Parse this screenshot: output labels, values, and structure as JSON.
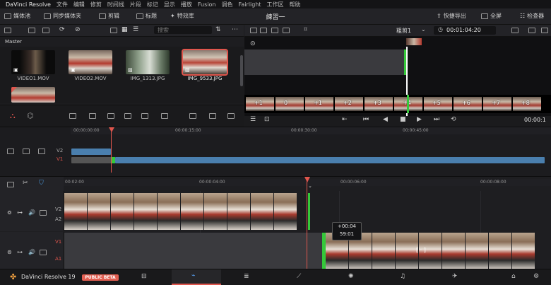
{
  "menu": [
    "DaVinci Resolve",
    "文件",
    "编辑",
    "修剪",
    "时间线",
    "片段",
    "标记",
    "显示",
    "播放",
    "Fusion",
    "调色",
    "Fairlight",
    "工作区",
    "帮助"
  ],
  "toolbar": {
    "media_pool": "媒体池",
    "sync_bin": "同步媒体夹",
    "clip": "剪辑",
    "titles": "标题",
    "effects": "特效库",
    "project_title": "練習一",
    "quick_export": "快捷导出",
    "fullscreen": "全屏",
    "inspector": "检查器"
  },
  "media_pool": {
    "search_placeholder": "搜索",
    "bin_name": "Master",
    "clips": [
      {
        "name": "VIDEO1.MOV"
      },
      {
        "name": "VIDEO2.MOV"
      },
      {
        "name": "IMG_1313.JPG"
      },
      {
        "name": "IMG_9533.JPG"
      }
    ]
  },
  "viewer": {
    "zoom": "粗剪1",
    "timecode": "00:01:04:20",
    "playhead_tc": "00:00:1",
    "film_labels": [
      "+1",
      "0",
      "+1",
      "+2",
      "+3",
      "+4",
      "+5",
      "+6",
      "+7",
      "+8"
    ]
  },
  "upper_timeline": {
    "ticks": [
      "00:00:00:00",
      "00:00:15:00",
      "00:00:30:00",
      "00:00:45:00"
    ],
    "tracks": [
      "V2",
      "V1"
    ]
  },
  "lower_timeline": {
    "ticks": [
      "00:02:00",
      "00:00:04:00",
      "00:00:06:00",
      "00:00:08:00"
    ],
    "tracks": [
      {
        "top": "V2",
        "bottom": "A2"
      },
      {
        "top": "V1",
        "bottom": "A1"
      }
    ],
    "tooltip_offset": "+00:04",
    "tooltip_frame": "59:01"
  },
  "bottom": {
    "app_name": "DaVinci Resolve 19",
    "badge": "PUBLIC BETA"
  },
  "colors": {
    "accent_red": "#e0564d",
    "clip_blue": "#4a7fae",
    "green_edge": "#35c83a"
  }
}
